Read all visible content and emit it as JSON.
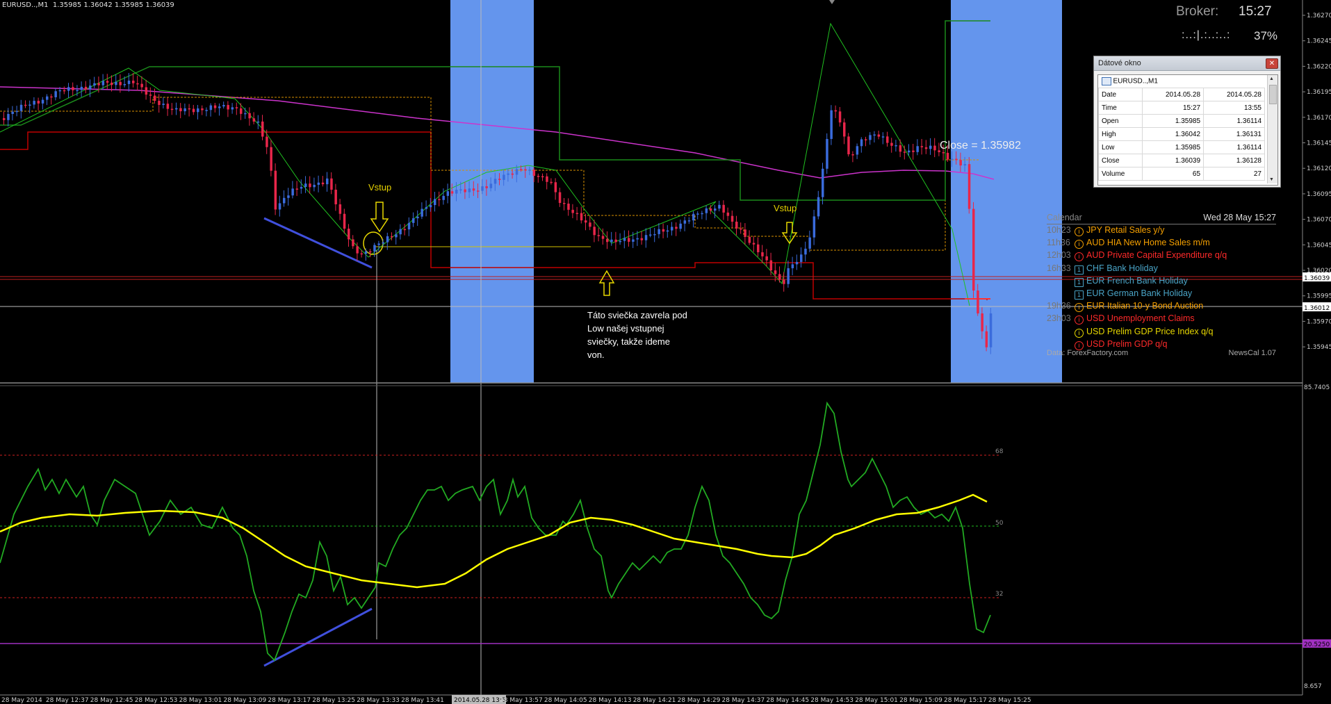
{
  "header": {
    "ohlc": "EURUSD..,M1  1.35985 1.36042 1.35985 1.36039"
  },
  "broker": {
    "label": "Broker:",
    "time": "15:27",
    "bar": ":..:|.:..:..:",
    "percent": "37%"
  },
  "data_window": {
    "title": "Dátové okno",
    "symbol": "EURUSD..,M1",
    "rows": [
      {
        "label": "Date",
        "v1": "2014.05.28",
        "v2": "2014.05.28"
      },
      {
        "label": "Time",
        "v1": "15:27",
        "v2": "13:55"
      },
      {
        "label": "Open",
        "v1": "1.35985",
        "v2": "1.36114"
      },
      {
        "label": "High",
        "v1": "1.36042",
        "v2": "1.36131"
      },
      {
        "label": "Low",
        "v1": "1.35985",
        "v2": "1.36114"
      },
      {
        "label": "Close",
        "v1": "1.36039",
        "v2": "1.36128"
      },
      {
        "label": "Volume",
        "v1": "65",
        "v2": "27"
      }
    ]
  },
  "calendar": {
    "title": "Calendar",
    "date": "Wed 28 May 15:27",
    "events": [
      {
        "time": "10h23",
        "icon": "i",
        "currency": "JPY",
        "name": "Retail Sales y/y",
        "color": "#f5a000"
      },
      {
        "time": "11h36",
        "icon": "i",
        "currency": "AUD",
        "name": "HIA New Home Sales m/m",
        "color": "#f5a000"
      },
      {
        "time": "12h03",
        "icon": "i",
        "currency": "AUD",
        "name": "Private Capital Expenditure q/q",
        "color": "#ff2a2a"
      },
      {
        "time": "16h33",
        "icon": "sq",
        "currency": "CHF",
        "name": "Bank Holiday",
        "color": "#4aa5c8"
      },
      {
        "time": "",
        "icon": "sq",
        "currency": "EUR",
        "name": "French Bank Holiday",
        "color": "#4aa5c8"
      },
      {
        "time": "",
        "icon": "sq",
        "currency": "EUR",
        "name": "German Bank Holiday",
        "color": "#4aa5c8"
      },
      {
        "time": "19h36",
        "icon": "i",
        "currency": "EUR",
        "name": "Italian 10-y Bond Auction",
        "color": "#f5a000"
      },
      {
        "time": "23h03",
        "icon": "i",
        "currency": "USD",
        "name": "Unemployment Claims",
        "color": "#ff2a2a"
      },
      {
        "time": "",
        "icon": "i",
        "currency": "USD",
        "name": "Prelim GDP Price Index q/q",
        "color": "#e8d800"
      },
      {
        "time": "",
        "icon": "i",
        "currency": "USD",
        "name": "Prelim GDP q/q",
        "color": "#ff2a2a"
      }
    ],
    "footer_left": "Data: ForexFactory.com",
    "footer_right": "NewsCal 1.07"
  },
  "annotations": {
    "vstup1": "Vstup",
    "vstup2": "Vstup",
    "note_lines": [
      "Táto sviečka zavrela pod",
      "Low našej vstupnej",
      "sviečky, takže ideme",
      "von."
    ],
    "close_label": "Close = 1.35982"
  },
  "price_axis": {
    "labels": [
      "1.36270",
      "1.36245",
      "1.36220",
      "1.36195",
      "1.36170",
      "1.36145",
      "1.36120",
      "1.36095",
      "1.36070",
      "1.36045",
      "1.36020",
      "1.35995",
      "1.35970",
      "1.35945"
    ],
    "highlight_labels": [
      "1.36039",
      "1.36012"
    ]
  },
  "indicator_axis": {
    "top": "85.7405",
    "bottom": "8.657",
    "levels": [
      "68",
      "50",
      "32"
    ],
    "highlight": "20.5250"
  },
  "time_axis": {
    "labels": [
      "28 May 2014",
      "28 May 12:37",
      "28 May 12:45",
      "28 May 12:53",
      "28 May 13:01",
      "28 May 13:09",
      "28 May 13:17",
      "28 May 13:25",
      "28 May 13:33",
      "28 May 13:41",
      "2014.05.28 13:55",
      "28 May 13:57",
      "28 May 14:05",
      "28 May 14:13",
      "28 May 14:21",
      "28 May 14:29",
      "28 May 14:37",
      "28 May 14:45",
      "28 May 14:53",
      "28 May 15:01",
      "28 May 15:09",
      "28 May 15:17",
      "28 May 15:25"
    ]
  },
  "colors": {
    "bull": "#3a6bdc",
    "bear": "#e8264a",
    "session": "#6495ed",
    "ma_magenta": "#cc33cc",
    "rsi": "#22aa22",
    "rsi_ma": "#ffff00"
  }
}
